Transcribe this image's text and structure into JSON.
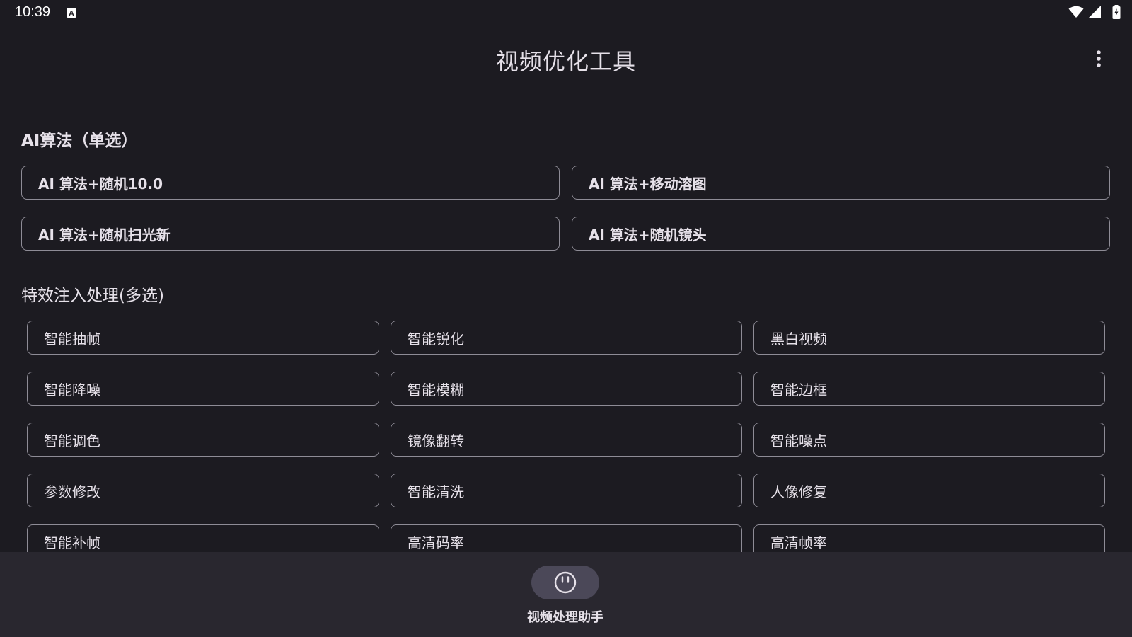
{
  "status_bar": {
    "time": "10:39",
    "icons": [
      "keyboard-a-icon",
      "wifi-icon",
      "signal-icon",
      "battery-charging-icon"
    ]
  },
  "app_bar": {
    "title": "视频优化工具",
    "menu_icon": "more-vert-icon"
  },
  "ai_section": {
    "title": "AI算法（单选）",
    "options": [
      {
        "label": "AI 算法+随机10.0"
      },
      {
        "label": "AI 算法+移动溶图"
      },
      {
        "label": "AI 算法+随机扫光新"
      },
      {
        "label": "AI 算法+随机镜头"
      }
    ]
  },
  "effects_section": {
    "title": "特效注入处理(多选)",
    "options": [
      {
        "label": "智能抽帧"
      },
      {
        "label": "智能锐化"
      },
      {
        "label": "黑白视频"
      },
      {
        "label": "智能降噪"
      },
      {
        "label": "智能模糊"
      },
      {
        "label": "智能边框"
      },
      {
        "label": "智能调色"
      },
      {
        "label": "镜像翻转"
      },
      {
        "label": "智能噪点"
      },
      {
        "label": "参数修改"
      },
      {
        "label": "智能清洗"
      },
      {
        "label": "人像修复"
      },
      {
        "label": "智能补帧"
      },
      {
        "label": "高清码率"
      },
      {
        "label": "高清帧率"
      }
    ]
  },
  "bottom_nav": {
    "items": [
      {
        "label": "视频处理助手",
        "icon": "smiley-face-icon"
      }
    ]
  },
  "colors": {
    "background": "#1c1b21",
    "nav_background": "#29272f",
    "nav_pill": "#4b4858",
    "button_border": "#8e8c96",
    "text": "#e6e1e9"
  }
}
